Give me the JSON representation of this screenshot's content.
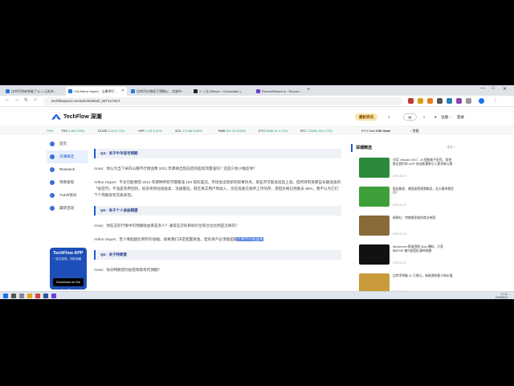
{
  "browser": {
    "tabs": [
      {
        "title": "比特币到底突破了11.1 元失的…",
        "color": "#2a7be4",
        "active": false
      },
      {
        "title": "YIA Arthur Hayes：山寨季钉…",
        "color": "#2a7be4",
        "active": true
      },
      {
        "title": "比特币价格低于预期以…实施中…",
        "color": "#2a7be4",
        "active": false
      },
      {
        "title": "X: 1 比 Bitman - Chainchain (…",
        "color": "#222222",
        "active": false
      },
      {
        "title": "RecordStream.io - Record…",
        "color": "#6b3fd4",
        "active": false
      }
    ],
    "url": "techflowpost.com/article/detail_25712.html",
    "window_controls": [
      "—",
      "□",
      "✕"
    ]
  },
  "site": {
    "logo_text": "TechFlow 深潮",
    "download_label": "最新资讯",
    "lang_label": "中",
    "register_label": "注册",
    "login_label": "登录",
    "sep": "/"
  },
  "ticker": [
    {
      "sym": "79%",
      "change": ""
    },
    {
      "sym": "TRX",
      "change": "0.28 2.53%"
    },
    {
      "sym": "DOGE",
      "change": "0.24 6.71%"
    },
    {
      "sym": "XRP",
      "change": "2.43 3.31%"
    },
    {
      "sym": "SOL",
      "change": "179.66 5.54%"
    },
    {
      "sym": "BNB",
      "change": "607.20 5.03%"
    },
    {
      "sym": "ETH",
      "change": "2658.31 4.71%"
    },
    {
      "sym": "BTC",
      "change": "111551.59 4.72%"
    }
  ],
  "gas": {
    "label": "ETH Gas",
    "value": "0.90 Gwei",
    "fear": "贪婪"
  },
  "sidenav": [
    {
      "label": "首页",
      "active": false
    },
    {
      "label": "深潮精选",
      "active": true
    },
    {
      "label": "Research",
      "active": false
    },
    {
      "label": "项目发现",
      "active": false
    },
    {
      "label": "7x24h快讯",
      "active": false
    },
    {
      "label": "最新活动",
      "active": false
    }
  ],
  "app_card": {
    "title": "TechFlow APP",
    "sub": "一站式发现，你的深潮",
    "store": "Download on the App Store"
  },
  "article": {
    "q4_title": "Q4：关于牛市信号预期",
    "q4_p1": "Anna：你认为当下关的山寨币行情会像 2021 年那样出现前后的超高顶量涨吗？还是只会小幅反弹？",
    "q4_p2": "Arthur Hayes：不太可能重现 2021 年那种所有币都暴涨 100 倍的盛况。市场会出现新的叙事热点，某些币可能会前后上涨，但所持有受那些长期涨涨的「低空币」不涨是有原因的，很多项目估值虚高、流通量低，缺乏真实用户和收入。仅在高质交易所上币的存，或但价格已经跌去 95%，我不认为它们下个周期会有实质表现。",
    "q5_title": "Q5：关于个人收益期望",
    "q5_p1": "Anna：你在这轮行情中的预期收益率是多少？通常这次的目标价位和仓位比例是怎样的？",
    "q5_p2_a": "Arthur Hayes：至少要超越比特币的涨幅。如果我们决定配置资金，但的资产必须能超越",
    "q5_p2_hl": "比特币的收益率",
    "q6_title": "Q6：关于特朗普",
    "q6_p1": "Anna：你对特朗普的加密政策有何预期？"
  },
  "rail": {
    "title": "深潮精选",
    "more": "更多 >",
    "items": [
      {
        "title": "对话 Virtuals CEO：AI 智能体不会死，如何推出我们的 ACP 协议能重新引入更多新元素",
        "date": "2025.05.22",
        "color": "#2c8a3a"
      },
      {
        "title": "报告解读：美国加密政策解读，怎么看待稳定币？",
        "date": "2025.05.22",
        "color": "#3fa03a"
      },
      {
        "title": "新鲜社：特朗普家族的商业帝国",
        "date": "2025.05.22",
        "color": "#8a6a3a"
      },
      {
        "title": "Movement 再陷困境 Sam 爆料：大家 $MOVE 被内部团队操纵抛售",
        "date": "2025.05.22",
        "color": "#111111"
      },
      {
        "title": "比特币突破 11 万美元，新能源的意义和价值",
        "date": "2025.05.22",
        "color": "#c89a3a"
      }
    ]
  },
  "taskbar": {
    "time": "17:11",
    "date": "2025/5/22"
  }
}
